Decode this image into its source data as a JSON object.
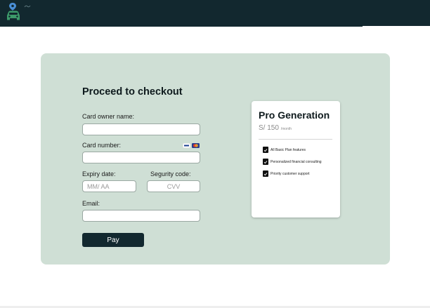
{
  "header": {
    "logo_icon": "car-location-icon",
    "colors": {
      "bar": "#12282f",
      "pin": "#4a8fd6",
      "car": "#3c9a6a"
    }
  },
  "checkout": {
    "title": "Proceed to checkout",
    "card_owner_label": "Card owner name:",
    "card_owner_value": "",
    "card_number_label": "Card number:",
    "card_number_value": "",
    "card_brand_icons": [
      "visa-icon",
      "mastercard-icon"
    ],
    "expiry_label": "Expiry date:",
    "expiry_placeholder": "MM/ AA",
    "security_label": "Segurity code:",
    "security_placeholder": "CVV",
    "email_label": "Email:",
    "email_value": "",
    "pay_label": "Pay",
    "colors": {
      "panel": "#cfdfd5",
      "button": "#12282f"
    }
  },
  "plan": {
    "name": "Pro Generation",
    "price": "S/ 150",
    "period": "/month",
    "features": [
      {
        "label": "All Basic Plan features",
        "checked": true
      },
      {
        "label": "Personalized financial consulting",
        "checked": true
      },
      {
        "label": "Priority customer support",
        "checked": true
      }
    ]
  }
}
